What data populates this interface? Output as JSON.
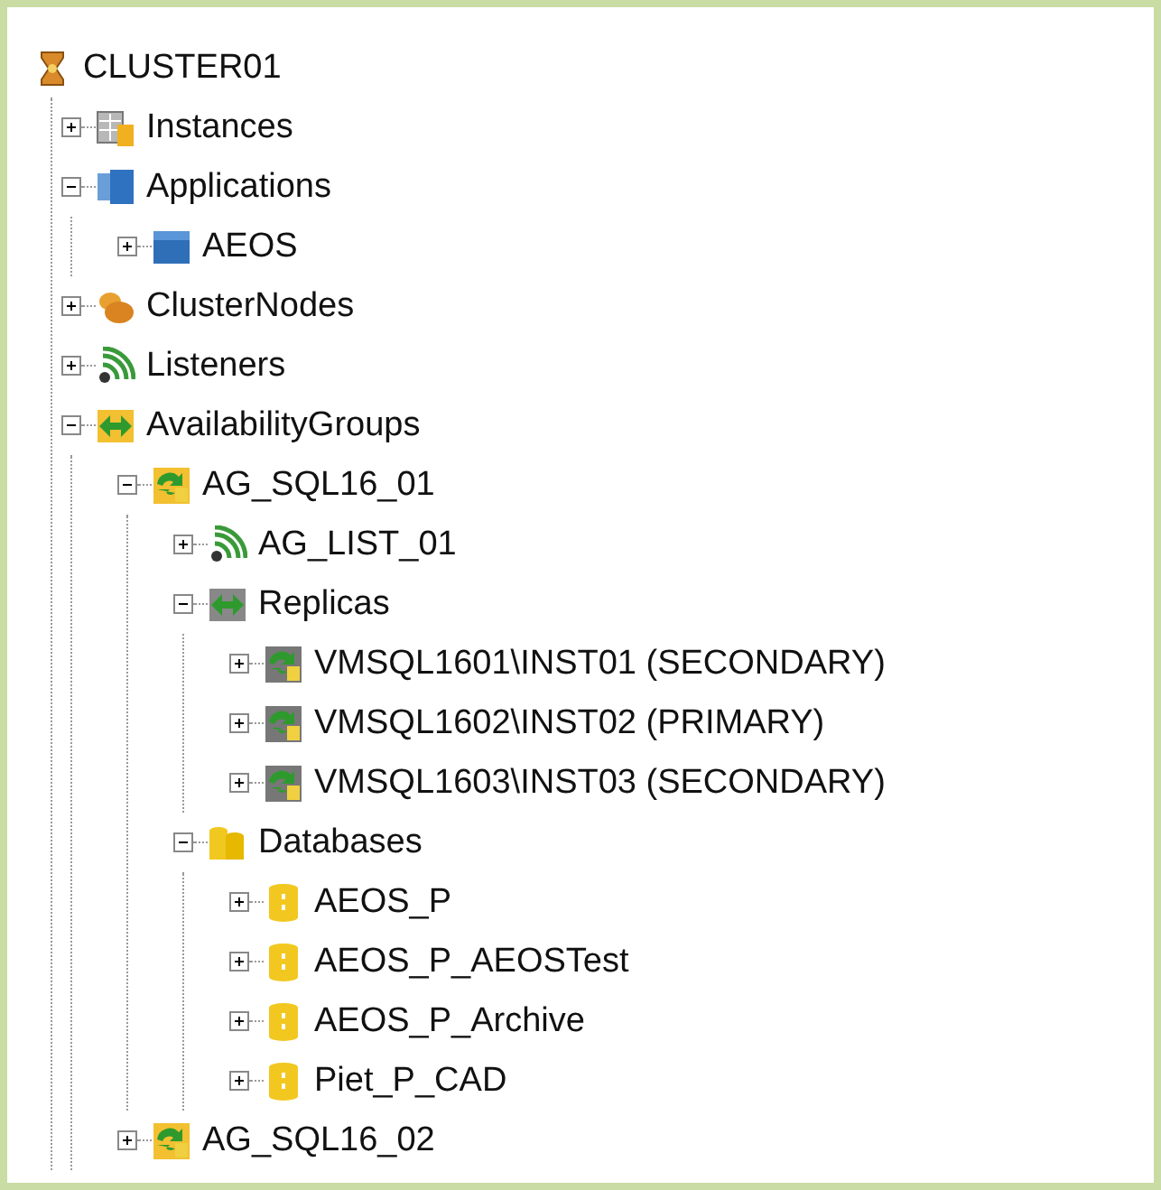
{
  "tree": [
    {
      "label": "CLUSTER01",
      "kind": "cluster",
      "children": [
        {
          "label": "Instances",
          "kind": "instances",
          "expanded": false
        },
        {
          "label": "Applications",
          "kind": "applications",
          "expanded": true,
          "children": [
            {
              "label": "AEOS",
              "kind": "application",
              "expanded": false
            }
          ]
        },
        {
          "label": "ClusterNodes",
          "kind": "nodes",
          "expanded": false
        },
        {
          "label": "Listeners",
          "kind": "listeners",
          "expanded": false
        },
        {
          "label": "AvailabilityGroups",
          "kind": "groups",
          "expanded": true,
          "children": [
            {
              "label": "AG_SQL16_01",
              "kind": "group",
              "expanded": true,
              "children": [
                {
                  "label": "AG_LIST_01",
                  "kind": "listener",
                  "expanded": false
                },
                {
                  "label": "Replicas",
                  "kind": "replicas",
                  "expanded": true,
                  "children": [
                    {
                      "label": "VMSQL1601\\INST01 (SECONDARY)",
                      "kind": "replica",
                      "expanded": false
                    },
                    {
                      "label": "VMSQL1602\\INST02 (PRIMARY)",
                      "kind": "replica",
                      "expanded": false
                    },
                    {
                      "label": "VMSQL1603\\INST03 (SECONDARY)",
                      "kind": "replica",
                      "expanded": false
                    }
                  ]
                },
                {
                  "label": "Databases",
                  "kind": "databases",
                  "expanded": true,
                  "children": [
                    {
                      "label": "AEOS_P",
                      "kind": "database",
                      "expanded": false
                    },
                    {
                      "label": "AEOS_P_AEOSTest",
                      "kind": "database",
                      "expanded": false
                    },
                    {
                      "label": "AEOS_P_Archive",
                      "kind": "database",
                      "expanded": false
                    },
                    {
                      "label": "Piet_P_CAD",
                      "kind": "database",
                      "expanded": false
                    }
                  ]
                }
              ]
            },
            {
              "label": "AG_SQL16_02",
              "kind": "group",
              "expanded": false
            }
          ]
        }
      ]
    }
  ]
}
